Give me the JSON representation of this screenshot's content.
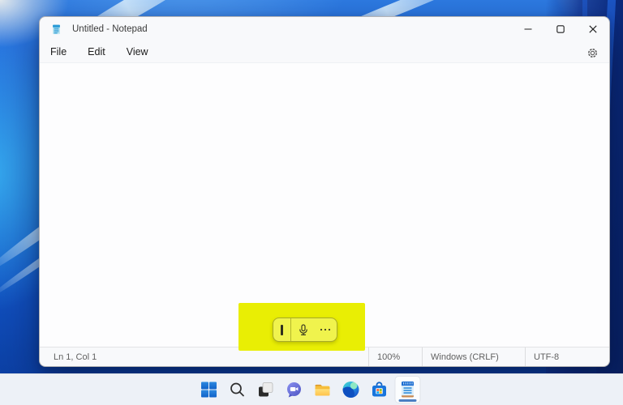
{
  "app": {
    "name": "Notepad",
    "window_title": "Untitled - Notepad"
  },
  "menu_bar": {
    "items": [
      "File",
      "Edit",
      "View"
    ],
    "settings_icon": "gear-icon"
  },
  "window_controls": [
    "minimize",
    "maximize",
    "close"
  ],
  "editor": {
    "text": ""
  },
  "status_bar": {
    "cursor_position": "Ln 1, Col 1",
    "zoom_level": "100%",
    "line_ending": "Windows (CRLF)",
    "encoding": "UTF-8"
  },
  "annotation": {
    "type": "highlight-rectangle",
    "color": "#e9ee04"
  },
  "voice_typing_toolbar": {
    "icons": [
      "text-cursor",
      "microphone-icon",
      "more-icon"
    ]
  },
  "taskbar": {
    "items": [
      {
        "name": "start",
        "icon": "windows-logo-icon",
        "active": false
      },
      {
        "name": "search",
        "icon": "search-icon",
        "active": false
      },
      {
        "name": "task-view",
        "icon": "task-view-icon",
        "active": false
      },
      {
        "name": "chat",
        "icon": "chat-icon",
        "active": false
      },
      {
        "name": "file-explorer",
        "icon": "folder-icon",
        "active": false
      },
      {
        "name": "edge",
        "icon": "edge-icon",
        "active": false
      },
      {
        "name": "store",
        "icon": "store-icon",
        "active": false
      },
      {
        "name": "notepad",
        "icon": "notepad-icon",
        "active": true
      }
    ]
  },
  "colors": {
    "taskbar_active_indicator": "#4a7ec2",
    "wallpaper_base": "#1c64d4",
    "highlight": "#e9ee04"
  }
}
